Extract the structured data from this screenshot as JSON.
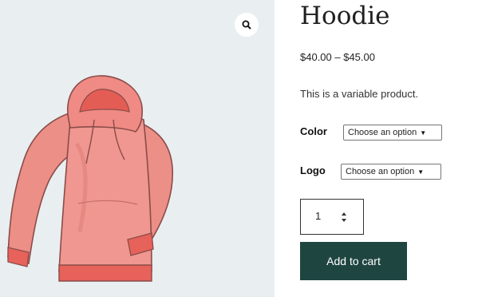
{
  "product": {
    "title": "Hoodie",
    "price": "$40.00 – $45.00",
    "description": "This is a variable product.",
    "image_icon": "zoom-magnifier-icon"
  },
  "attributes": {
    "color": {
      "label": "Color",
      "selected": "Choose an option"
    },
    "logo": {
      "label": "Logo",
      "selected": "Choose an option"
    }
  },
  "quantity": {
    "value": "1"
  },
  "actions": {
    "add_to_cart": "Add to cart"
  },
  "colors": {
    "image_background": "#e9eef1",
    "hoodie": "#ec8f86",
    "button": "#1f4541"
  }
}
